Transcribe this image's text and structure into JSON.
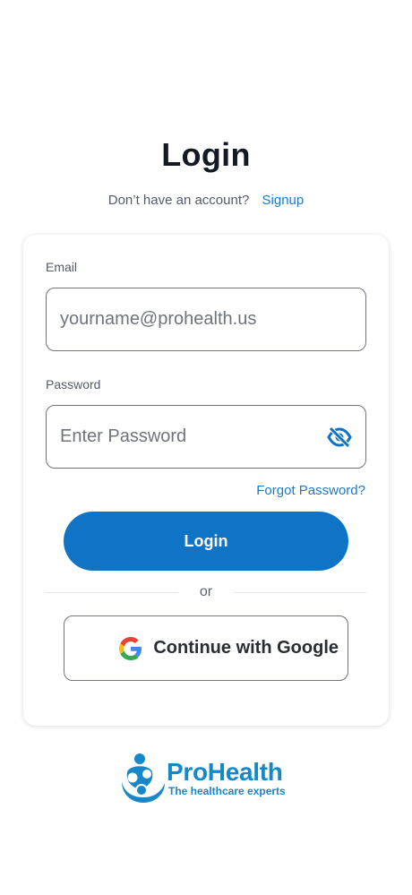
{
  "header": {
    "title": "Login",
    "no_account_text": "Don’t have an account?",
    "signup_link": "Signup"
  },
  "form": {
    "email_label": "Email",
    "email_placeholder": "yourname@prohealth.us",
    "email_value": "",
    "password_label": "Password",
    "password_placeholder": "Enter Password",
    "password_value": "",
    "password_toggle_icon": "eye-off-icon",
    "forgot_password": "Forgot Password?",
    "login_button": "Login",
    "divider_text": "or",
    "google_button": "Continue with Google",
    "google_icon": "google-icon"
  },
  "brand": {
    "name": "ProHealth",
    "tagline": "The healthcare experts"
  },
  "colors": {
    "primary": "#0f73c6",
    "link": "#1a7bc4",
    "brand": "#1688c9"
  }
}
